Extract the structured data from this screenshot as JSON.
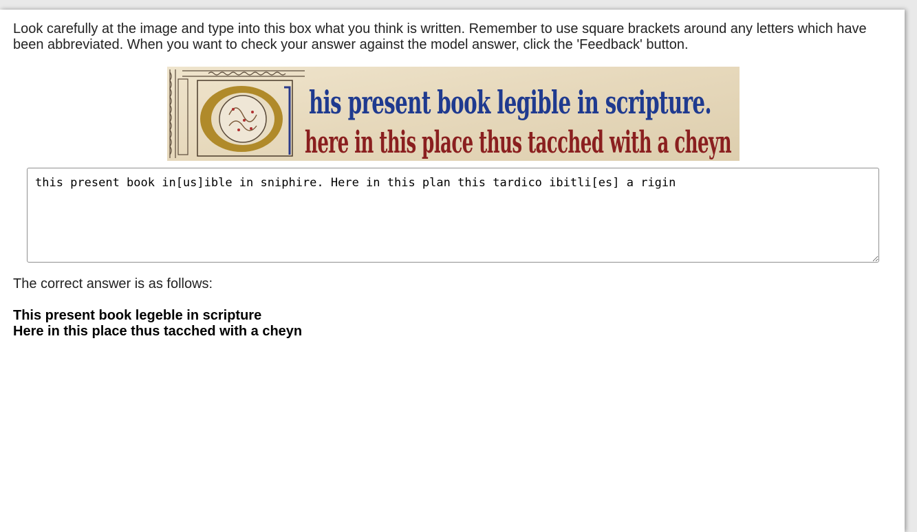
{
  "instructions": "Look carefully at the image and type into this box what you think is written. Remember to use square brackets around any letters which have been abbreviated. When you want to check your answer against the model answer, click the 'Feedback' button.",
  "manuscript_image": {
    "line1": "This present book legible in scripture.",
    "line2": "Here in this place thus tacched with a cheyn",
    "colors": {
      "parchment": "#e8dcc2",
      "blue_ink": "#1f3a8f",
      "red_ink": "#8a1f1f",
      "gold": "#b08a2a"
    }
  },
  "answer_box": {
    "value": "this present book in[us]ible in sniphire. Here in this plan this tardico ibitli[es] a rigin"
  },
  "feedback": {
    "intro": "The correct answer is as follows:",
    "lines": [
      "This present book legeble in scripture",
      "Here in this place thus tacched with a cheyn"
    ]
  }
}
